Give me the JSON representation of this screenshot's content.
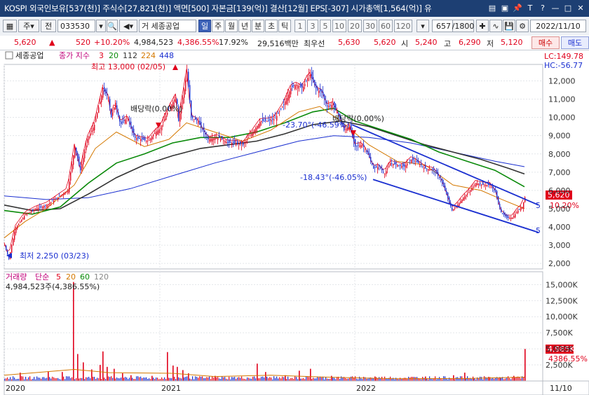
{
  "titlebar": {
    "text": "KOSPI 외국인보유[537(천)] 주식수[27,821(천)] 액면[500] 자본금[139(억)] 결산[12월] EPS[-307] 시가총액[1,564(억)] 유",
    "icons": [
      "window-icon",
      "restore-icon",
      "pin-icon",
      "font-T-icon",
      "help-icon",
      "minimize-icon",
      "maximize-icon",
      "close-icon"
    ],
    "icon_glyphs": [
      "▤",
      "▣",
      "📌",
      "T",
      "?",
      "—",
      "□",
      "✕"
    ]
  },
  "toolbar": {
    "market_label": "주",
    "scope_label": "전",
    "code": "033530",
    "stock_name": "세종공업",
    "prefix": "거",
    "periods": [
      "일",
      "주",
      "월",
      "년",
      "분",
      "초",
      "틱"
    ],
    "selected_period": "일",
    "intervals": [
      "1",
      "3",
      "5",
      "10",
      "20",
      "30",
      "60",
      "120"
    ],
    "count": "657",
    "total": "/1800",
    "date": "2022/11/10"
  },
  "quote": {
    "price": "5,620",
    "change": "520",
    "change_pct": "+10.20%",
    "volume": "4,984,523",
    "volume_pct": "4,386.55%",
    "turnover": "17.92%",
    "amount": "29,516백만",
    "best_ask_label": "최우선",
    "best_ask": "5,630",
    "best_bid": "5,620",
    "open_label": "시",
    "open": "5,240",
    "high_label": "고",
    "high": "6,290",
    "low_label": "저",
    "low": "5,120",
    "buy_label": "매수",
    "sell_label": "매도"
  },
  "chart_data": {
    "type": "candlestick",
    "title": "세종공업",
    "legend": {
      "label": "종가 지수",
      "periods": [
        "3",
        "20",
        "112",
        "224",
        "448"
      ],
      "colors": [
        "#e0001b",
        "#0a8a0a",
        "#333333",
        "#d47800",
        "#1a2fd0"
      ]
    },
    "x_ticks": [
      "2020",
      "2021",
      "2022"
    ],
    "last_label": "11/10",
    "y_ticks": [
      "12,000",
      "11,000",
      "10,000",
      "9,000",
      "8,000",
      "7,000",
      "6,000",
      "5,000",
      "4,000",
      "3,000",
      "2,000"
    ],
    "ylim": [
      1700,
      12900
    ],
    "lc": "LC:149.78",
    "hc": "HC:-56.77",
    "last_price": "5,620",
    "last_pct": "10.20%",
    "right_edge_labels": [
      "5",
      "5"
    ],
    "annotations": {
      "high": "최고 13,000 (02/05)",
      "low": "최저 2,250 (03/23)",
      "dividend": "배당락(0.00%)",
      "dividend2": "배당락(0.00%)",
      "angle1": "-23.70°(-46.59%)",
      "angle2": "-18.43°(-46.05%)"
    },
    "price_path": [
      [
        0,
        3000
      ],
      [
        6,
        2250
      ],
      [
        15,
        3900
      ],
      [
        30,
        4700
      ],
      [
        45,
        5000
      ],
      [
        60,
        5200
      ],
      [
        75,
        5600
      ],
      [
        90,
        6000
      ],
      [
        100,
        8400
      ],
      [
        108,
        7100
      ],
      [
        118,
        8800
      ],
      [
        128,
        9600
      ],
      [
        140,
        11500
      ],
      [
        148,
        11100
      ],
      [
        152,
        10000
      ],
      [
        158,
        10800
      ],
      [
        165,
        9600
      ],
      [
        175,
        10000
      ],
      [
        185,
        8900
      ],
      [
        195,
        8800
      ],
      [
        205,
        8700
      ],
      [
        215,
        9200
      ],
      [
        222,
        9400
      ],
      [
        230,
        10100
      ],
      [
        238,
        10700
      ],
      [
        245,
        11200
      ],
      [
        248,
        9800
      ],
      [
        255,
        11300
      ],
      [
        260,
        12500
      ],
      [
        266,
        10000
      ],
      [
        275,
        9800
      ],
      [
        290,
        8800
      ],
      [
        305,
        8900
      ],
      [
        318,
        8600
      ],
      [
        330,
        8600
      ],
      [
        340,
        8500
      ],
      [
        352,
        9100
      ],
      [
        365,
        9800
      ],
      [
        375,
        9800
      ],
      [
        385,
        9900
      ],
      [
        398,
        10700
      ],
      [
        408,
        11600
      ],
      [
        415,
        11800
      ],
      [
        425,
        11600
      ],
      [
        435,
        12400
      ],
      [
        445,
        11500
      ],
      [
        452,
        11400
      ],
      [
        460,
        10600
      ],
      [
        468,
        10700
      ],
      [
        476,
        10100
      ],
      [
        484,
        9300
      ],
      [
        492,
        9500
      ],
      [
        500,
        8400
      ],
      [
        510,
        8500
      ],
      [
        518,
        8000
      ],
      [
        526,
        7200
      ],
      [
        534,
        7300
      ],
      [
        542,
        6900
      ],
      [
        550,
        7500
      ],
      [
        560,
        7400
      ],
      [
        570,
        7300
      ],
      [
        580,
        7700
      ],
      [
        590,
        7500
      ],
      [
        600,
        7200
      ],
      [
        612,
        7100
      ],
      [
        622,
        6600
      ],
      [
        630,
        5800
      ],
      [
        638,
        4900
      ],
      [
        646,
        5200
      ],
      [
        654,
        5600
      ],
      [
        662,
        5900
      ],
      [
        672,
        6400
      ],
      [
        682,
        6300
      ],
      [
        692,
        6300
      ],
      [
        700,
        5900
      ],
      [
        708,
        4800
      ],
      [
        716,
        4500
      ],
      [
        724,
        4500
      ],
      [
        732,
        4900
      ],
      [
        738,
        5100
      ],
      [
        742,
        5620
      ]
    ],
    "ma3_offsets": [
      [
        0,
        -100
      ],
      [
        742,
        -100
      ]
    ],
    "ma20_path": [
      [
        0,
        3400
      ],
      [
        30,
        4300
      ],
      [
        60,
        5000
      ],
      [
        100,
        6300
      ],
      [
        130,
        8300
      ],
      [
        160,
        9200
      ],
      [
        200,
        8400
      ],
      [
        235,
        8800
      ],
      [
        260,
        9700
      ],
      [
        300,
        9200
      ],
      [
        340,
        8700
      ],
      [
        380,
        9300
      ],
      [
        420,
        10300
      ],
      [
        450,
        10600
      ],
      [
        480,
        9800
      ],
      [
        520,
        8500
      ],
      [
        560,
        7600
      ],
      [
        600,
        7400
      ],
      [
        640,
        6300
      ],
      [
        680,
        6000
      ],
      [
        710,
        5500
      ],
      [
        742,
        5000
      ]
    ],
    "ma112_path": [
      [
        0,
        4900
      ],
      [
        40,
        4700
      ],
      [
        80,
        5100
      ],
      [
        120,
        6400
      ],
      [
        160,
        7500
      ],
      [
        200,
        8000
      ],
      [
        240,
        8600
      ],
      [
        280,
        8900
      ],
      [
        320,
        8900
      ],
      [
        360,
        9200
      ],
      [
        400,
        9700
      ],
      [
        440,
        10300
      ],
      [
        470,
        10500
      ],
      [
        500,
        9800
      ],
      [
        540,
        9300
      ],
      [
        580,
        8800
      ],
      [
        620,
        8100
      ],
      [
        660,
        7600
      ],
      [
        700,
        7100
      ],
      [
        742,
        6200
      ]
    ],
    "ma224_path": [
      [
        0,
        5200
      ],
      [
        40,
        4900
      ],
      [
        80,
        5000
      ],
      [
        120,
        5800
      ],
      [
        160,
        6700
      ],
      [
        200,
        7400
      ],
      [
        240,
        7900
      ],
      [
        280,
        8300
      ],
      [
        320,
        8500
      ],
      [
        360,
        8700
      ],
      [
        400,
        9100
      ],
      [
        440,
        9600
      ],
      [
        480,
        9800
      ],
      [
        520,
        9500
      ],
      [
        560,
        9000
      ],
      [
        600,
        8500
      ],
      [
        640,
        8100
      ],
      [
        680,
        7700
      ],
      [
        720,
        7200
      ],
      [
        742,
        6900
      ]
    ],
    "ma448_path": [
      [
        0,
        5700
      ],
      [
        60,
        5500
      ],
      [
        120,
        5600
      ],
      [
        180,
        6100
      ],
      [
        240,
        6800
      ],
      [
        300,
        7500
      ],
      [
        360,
        8100
      ],
      [
        420,
        8700
      ],
      [
        470,
        9000
      ],
      [
        520,
        8900
      ],
      [
        580,
        8600
      ],
      [
        640,
        8100
      ],
      [
        700,
        7600
      ],
      [
        742,
        7300
      ]
    ],
    "trend_lines": [
      {
        "from": [
          496,
          9600
        ],
        "to": [
          762,
          5200
        ],
        "color": "#1a2fd0"
      },
      {
        "from": [
          526,
          6600
        ],
        "to": [
          762,
          3700
        ],
        "color": "#1a2fd0"
      }
    ],
    "volume": {
      "label": "거래량",
      "legend_label": "단순",
      "periods": [
        "5",
        "20",
        "60",
        "120"
      ],
      "period_colors": [
        "#e0001b",
        "#d47800",
        "#0a8a0a",
        "#888888"
      ],
      "value": "4,984,523주(4,386.55%)",
      "y_ticks": [
        "15,000K",
        "12,500K",
        "10,000K",
        "7,500K",
        "5,000K",
        "2,500K"
      ],
      "ylim": [
        0,
        17000
      ],
      "last_vol": "4,985K",
      "last_pct": "4386.55%",
      "spikes": [
        [
          22,
          1300
        ],
        [
          62,
          1500
        ],
        [
          82,
          1400
        ],
        [
          98,
          15400
        ],
        [
          104,
          4200
        ],
        [
          112,
          2900
        ],
        [
          124,
          1800
        ],
        [
          136,
          2500
        ],
        [
          140,
          4600
        ],
        [
          146,
          2200
        ],
        [
          156,
          1900
        ],
        [
          168,
          1200
        ],
        [
          180,
          900
        ],
        [
          210,
          800
        ],
        [
          232,
          4500
        ],
        [
          240,
          2400
        ],
        [
          246,
          2200
        ],
        [
          254,
          1700
        ],
        [
          262,
          1200
        ],
        [
          300,
          800
        ],
        [
          360,
          2700
        ],
        [
          372,
          1400
        ],
        [
          400,
          900
        ],
        [
          420,
          1600
        ],
        [
          436,
          1900
        ],
        [
          466,
          800
        ],
        [
          528,
          700
        ],
        [
          600,
          700
        ],
        [
          640,
          900
        ],
        [
          656,
          1300
        ],
        [
          668,
          400
        ],
        [
          690,
          600
        ],
        [
          706,
          500
        ],
        [
          726,
          800
        ],
        [
          742,
          4985
        ]
      ]
    }
  }
}
